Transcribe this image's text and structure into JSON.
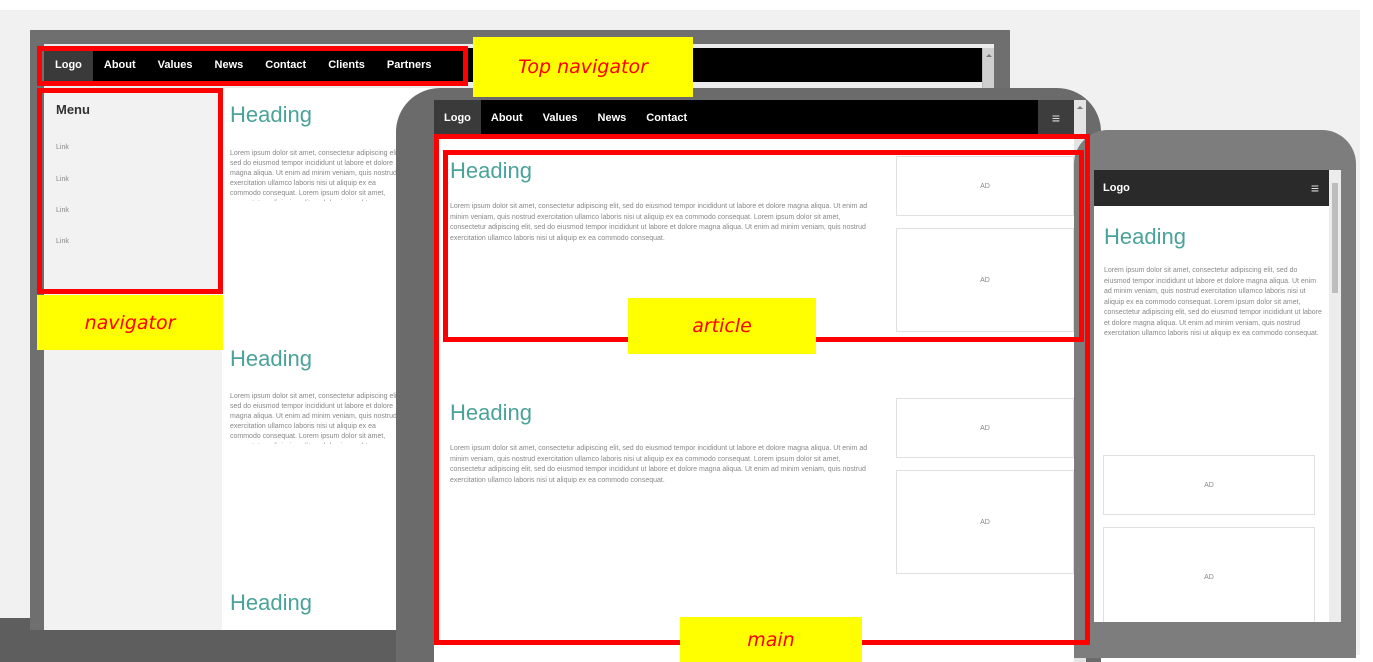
{
  "desktop": {
    "nav_items": [
      "Logo",
      "About",
      "Values",
      "News",
      "Contact",
      "Clients",
      "Partners"
    ],
    "menu_title": "Menu",
    "menu_links": [
      "Link",
      "Link",
      "Link",
      "Link"
    ],
    "headings": [
      "Heading",
      "Heading",
      "Heading"
    ],
    "paragraph": "Lorem ipsum dolor sit amet, consectetur adipiscing elit, sed do eiusmod tempor incididunt ut labore et dolore magna aliqua. Ut enim ad minim veniam, quis nostrud exercitation ullamco laboris nisi ut aliquip ex ea commodo consequat. Lorem ipsum dolor sit amet, consectetur adipiscing elit, sed do eiusmod tempor incididunt ut labore et dolore magna aliqua. Ut enim ad minim veniam, quis nostrud exercitation ullamco laboris nisi ut aliquip ex ea commodo consequat."
  },
  "tablet": {
    "nav_items": [
      "Logo",
      "About",
      "Values",
      "News",
      "Contact"
    ],
    "menu_glyph": "≡",
    "headings": [
      "Heading",
      "Heading"
    ],
    "paragraph": "Lorem ipsum dolor sit amet, consectetur adipiscing elit, sed do eiusmod tempor incididunt ut labore et dolore magna aliqua. Ut enim ad minim veniam, quis nostrud exercitation ullamco laboris nisi ut aliquip ex ea commodo consequat. Lorem ipsum dolor sit amet, consectetur adipiscing elit, sed do eiusmod tempor incididunt ut labore et dolore magna aliqua. Ut enim ad minim veniam, quis nostrud exercitation ullamco laboris nisi ut aliquip ex ea commodo consequat.",
    "ad_label": "AD"
  },
  "phone": {
    "logo": "Logo",
    "menu_glyph": "≡",
    "heading": "Heading",
    "paragraph": "Lorem ipsum dolor sit amet, consectetur adipiscing elit, sed do eiusmod tempor incididunt ut labore et dolore magna aliqua. Ut enim ad minim veniam, quis nostrud exercitation ullamco laboris nisi ut aliquip ex ea commodo consequat. Lorem ipsum dolor sit amet, consectetur adipiscing elit, sed do eiusmod tempor incididunt ut labore et dolore magna aliqua. Ut enim ad minim veniam, quis nostrud exercitation ullamco laboris nisi ut aliquip ex ea commodo consequat.",
    "ad_label": "AD"
  },
  "annotations": {
    "top_navigator": "Top navigator",
    "navigator": "navigator",
    "article": "article",
    "main": "main"
  },
  "colors": {
    "annotation_box": "#ff0000",
    "annotation_label_bg": "#ffff00",
    "heading": "#4aa39a"
  }
}
